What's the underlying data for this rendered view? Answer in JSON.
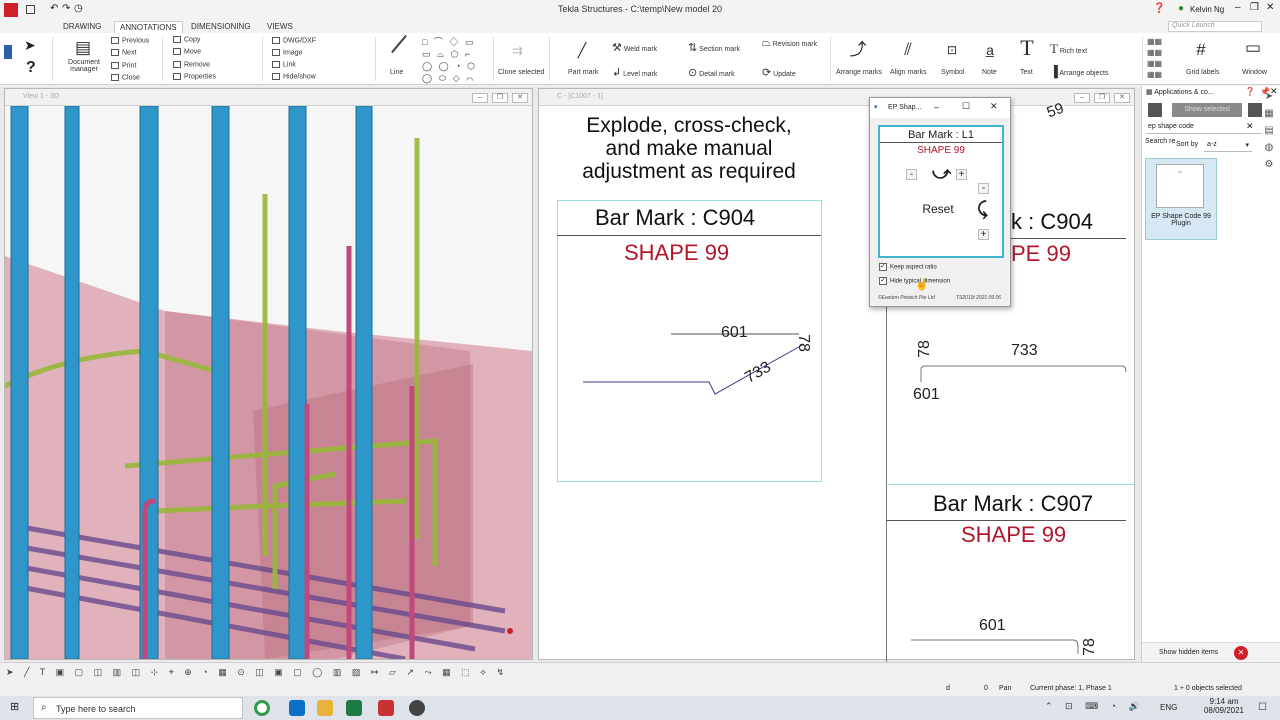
{
  "app": {
    "title": "Tekla Structures - C:\\temp\\New model 20",
    "user": "Kelvin Ng",
    "quick_launch_placeholder": "Quick Launch"
  },
  "ribbon": {
    "tabs": [
      {
        "label": "DRAWING"
      },
      {
        "label": "ANNOTATIONS"
      },
      {
        "label": "DIMENSIONING"
      },
      {
        "label": "VIEWS"
      }
    ],
    "doc_manager": "Document manager",
    "nav": [
      "Previous",
      "Next",
      "Print",
      "Close"
    ],
    "edit": [
      "Copy",
      "Move",
      "Remove",
      "Properties"
    ],
    "insert": [
      "DWG/DXF",
      "Image",
      "Link",
      "Hide/show"
    ],
    "line": "Line",
    "clone": "Clone selected",
    "part_mark": "Part mark",
    "weld_mark": "Weld mark",
    "level_mark": "Level mark",
    "section_mark": "Section mark",
    "detail_mark": "Detail mark",
    "revision_mark": "Revision mark",
    "update": "Update",
    "arrange_marks": "Arrange marks",
    "align_marks": "Align marks",
    "symbol": "Symbol",
    "note": "Note",
    "text": "Text",
    "rich_text": "Rich text",
    "arrange_objects": "Arrange objects",
    "grid_labels": "Grid labels",
    "window": "Window"
  },
  "view3d": {
    "title": "View 1 - 3D"
  },
  "drawing": {
    "title": "C - [C1007 - 1]",
    "instruction": [
      "Explode, cross-check,",
      "and make manual",
      "adjustment as required"
    ],
    "box1": {
      "bar_mark": "Bar Mark : C904",
      "shape": "SHAPE 99",
      "dim1": "601",
      "dim2": "733",
      "dim3": "78"
    },
    "box2": {
      "bar_mark": "k : C904",
      "shape": "PE 99",
      "dim1": "78",
      "dim2": "733",
      "dim3": "601",
      "top": "59"
    },
    "box3": {
      "bar_mark": "Bar Mark : C907",
      "shape": "SHAPE 99",
      "dim1": "601",
      "dim2": "78"
    }
  },
  "dialog": {
    "title": "EP Shap...",
    "bar_mark": "Bar Mark : L1",
    "shape": "SHAPE 99",
    "minus": "-",
    "plus": "+",
    "reset": "Reset",
    "keep_aspect": "Keep aspect ratio",
    "hide_typical": "Hide typical dimension",
    "footer_left": "©Eastern Pretech Pte Ltd",
    "footer_right": "TS2019i 2021.09.06"
  },
  "apps": {
    "title": "Applications & co...",
    "show_selected": "Show selected",
    "search_value": "ep shape code",
    "search_result": "Search re",
    "sort_label": "Sort by",
    "sort_value": "a-z",
    "plugin_name": "EP Shape Code 99 Plugin",
    "show_hidden": "Show hidden items"
  },
  "status": {
    "d": "d",
    "zero": "0",
    "pan": "Pan",
    "phase": "Current phase: 1, Phase 1",
    "selected": "1 + 0 objects selected"
  },
  "taskbar": {
    "search_placeholder": "Type here to search",
    "lang": "ENG",
    "time": "9:14 am",
    "date": "08/09/2021"
  },
  "colors": {
    "accent": "#3fb4cc",
    "shape_red": "#b3162a",
    "rebar_blue": "#2e96c8",
    "rebar_green": "#98b83a",
    "rebar_pink": "#c0487a",
    "concrete": "#d99aa8"
  }
}
